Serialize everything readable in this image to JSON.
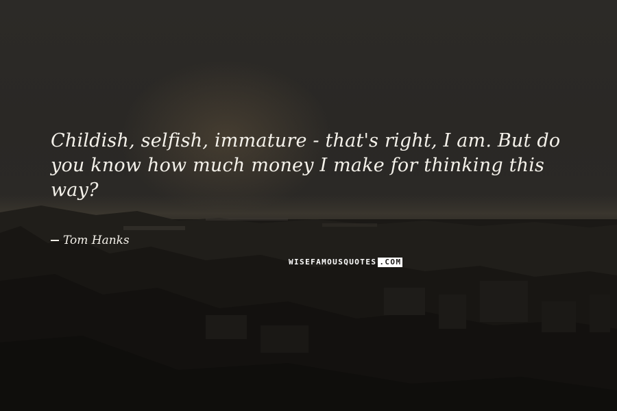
{
  "quote": {
    "text": "Childish, selfish, immature - that's right, I am. But do you know how much money I make for thinking this way?"
  },
  "author": {
    "name": "Tom Hanks"
  },
  "watermark": {
    "part1": "WISEFAMOUSQUOTES",
    "part2": ".COM"
  },
  "colors": {
    "text": "#f4f1ea",
    "background": "#1c1a18"
  }
}
